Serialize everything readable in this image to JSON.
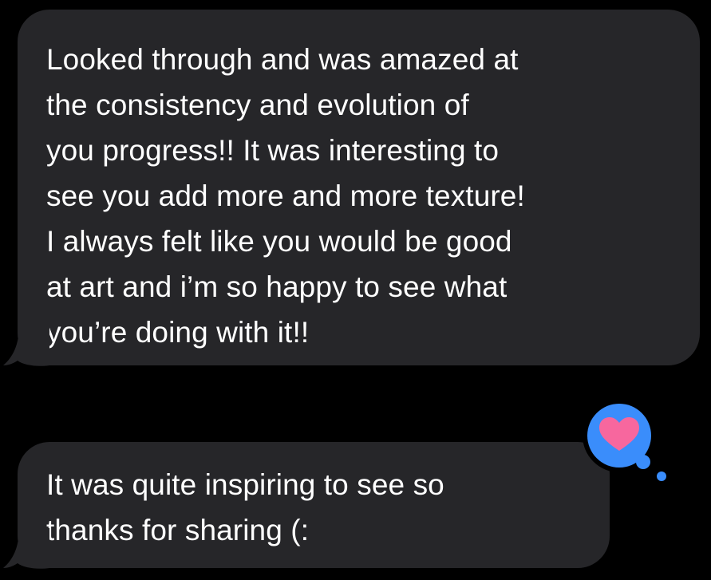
{
  "messages": [
    {
      "lines": [
        "Looked through and was amazed at",
        "the consistency and evolution of",
        "you progress!! It was interesting to",
        "see you add more and more texture!",
        "I always felt like you would be good",
        "at art and i’m so happy to see what",
        "you’re doing with it!!"
      ]
    },
    {
      "lines": [
        "It was quite inspiring to see so",
        "thanks for sharing (:"
      ],
      "reaction": "heart-icon"
    }
  ],
  "colors": {
    "background": "#000000",
    "bubble": "#262629",
    "text": "#ffffff",
    "reaction_bubble": "#3a8dfb",
    "heart": "#f7679e"
  }
}
